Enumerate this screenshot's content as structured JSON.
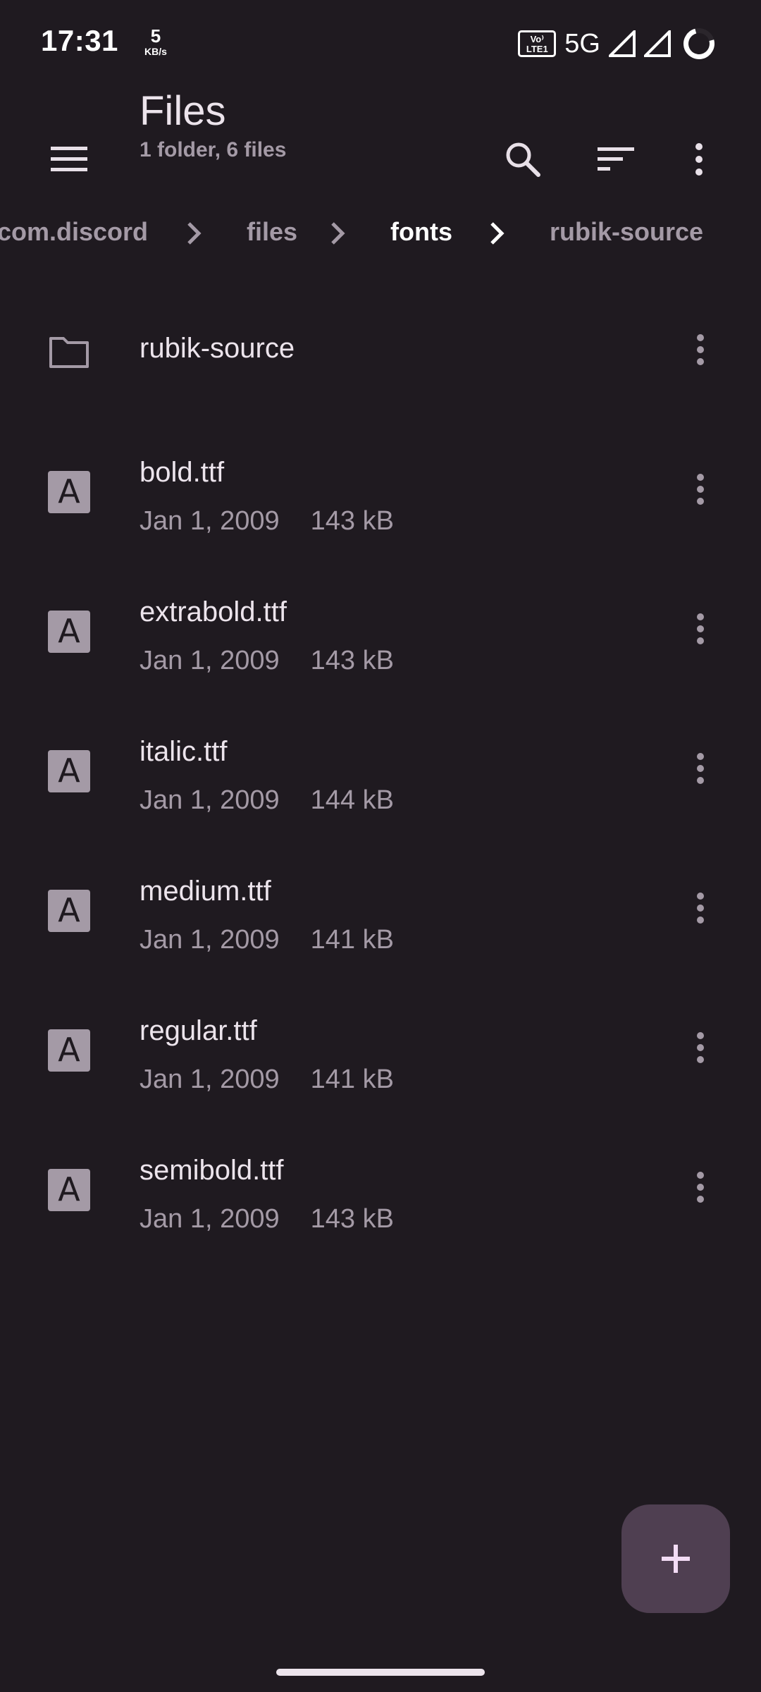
{
  "status_bar": {
    "time": "17:31",
    "speed_value": "5",
    "speed_unit": "KB/s",
    "volte_top": "Vo⁾",
    "volte_bottom": "LTE1",
    "network": "5G"
  },
  "app_bar": {
    "title": "Files",
    "subtitle": "1 folder, 6 files",
    "icons": [
      "menu-icon",
      "search-icon",
      "sort-icon",
      "more-vert-icon"
    ]
  },
  "breadcrumb": [
    {
      "label": "com.discord",
      "active": false
    },
    {
      "label": "files",
      "active": false
    },
    {
      "label": "fonts",
      "active": true
    },
    {
      "label": "rubik-source",
      "active": false
    }
  ],
  "folders": [
    {
      "name": "rubik-source",
      "icon": "folder-icon"
    }
  ],
  "files": [
    {
      "name": "bold.ttf",
      "date": "Jan 1, 2009",
      "size": "143 kB",
      "icon": "font-file-icon",
      "glyph": "A"
    },
    {
      "name": "extrabold.ttf",
      "date": "Jan 1, 2009",
      "size": "143 kB",
      "icon": "font-file-icon",
      "glyph": "A"
    },
    {
      "name": "italic.ttf",
      "date": "Jan 1, 2009",
      "size": "144 kB",
      "icon": "font-file-icon",
      "glyph": "A"
    },
    {
      "name": "medium.ttf",
      "date": "Jan 1, 2009",
      "size": "141 kB",
      "icon": "font-file-icon",
      "glyph": "A"
    },
    {
      "name": "regular.ttf",
      "date": "Jan 1, 2009",
      "size": "141 kB",
      "icon": "font-file-icon",
      "glyph": "A"
    },
    {
      "name": "semibold.ttf",
      "date": "Jan 1, 2009",
      "size": "143 kB",
      "icon": "font-file-icon",
      "glyph": "A"
    }
  ],
  "fab": {
    "icon": "plus-icon"
  },
  "colors": {
    "background": "#1f1a20",
    "primary_text": "#ece4ec",
    "secondary_text": "#a49aa6",
    "fab": "#4f3f51"
  }
}
